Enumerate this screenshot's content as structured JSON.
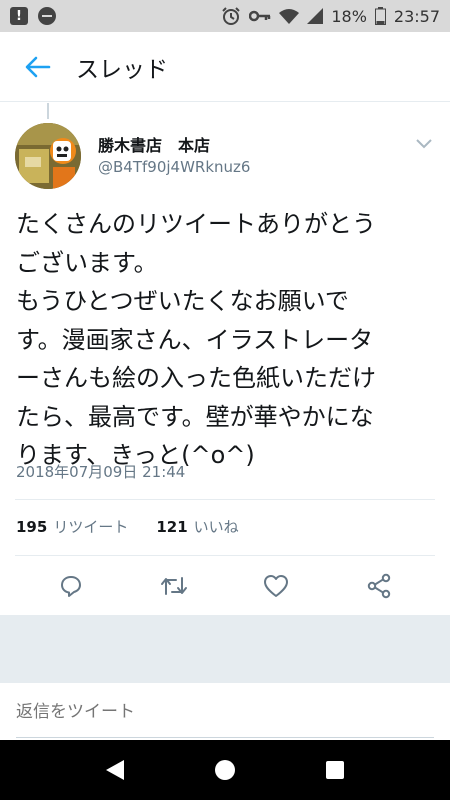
{
  "status_bar": {
    "battery_percent": "18%",
    "time": "23:57",
    "icons": [
      "alert-icon",
      "do-not-disturb-icon",
      "alarm-icon",
      "key-icon",
      "wifi-icon",
      "signal-icon",
      "battery-icon"
    ]
  },
  "header": {
    "back_icon": "arrow-left-icon",
    "title": "スレッド"
  },
  "tweet": {
    "author_name": "勝木書店　本店",
    "author_handle": "@B4Tf90j4WRknuz6",
    "text": "たくさんのリツイートありがとう\nございます。\nもうひとつぜいたくなお願いで\nす。漫画家さん、イラストレータ\nーさんも絵の入った色紙いただけ\nたら、最高です。壁が華やかにな\nります、きっと(^o^)",
    "timestamp": "2018年07月09日 21:44",
    "retweet_count": "195",
    "retweet_label": "リツイート",
    "like_count": "121",
    "like_label": "いいね"
  },
  "actions": [
    {
      "name": "reply-icon"
    },
    {
      "name": "retweet-icon"
    },
    {
      "name": "like-icon"
    },
    {
      "name": "share-icon"
    }
  ],
  "reply": {
    "placeholder": "返信をツイート"
  },
  "colors": {
    "accent": "#1da1f2",
    "secondary_text": "#657786",
    "divider": "#e6ecf0"
  }
}
